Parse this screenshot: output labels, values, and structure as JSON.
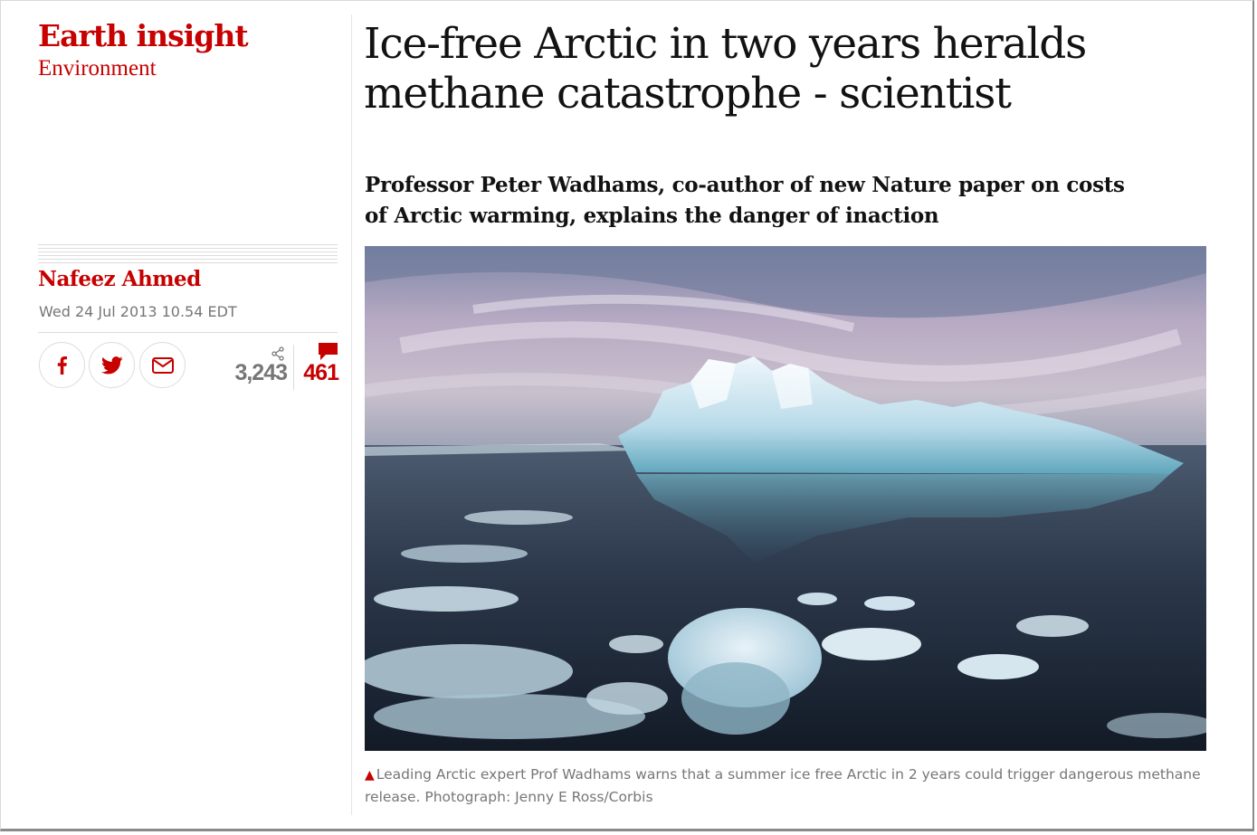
{
  "article": {
    "series": "Earth insight",
    "section": "Environment",
    "headline": "Ice-free Arctic in two years heralds methane catastrophe - scientist",
    "standfirst": "Professor Peter Wadhams, co-author of new Nature paper on costs of Arctic warming, explains the danger of inaction",
    "byline": "Nafeez Ahmed",
    "dateline": "Wed 24 Jul 2013 10.54 EDT"
  },
  "share": {
    "buttons": [
      {
        "name": "facebook",
        "icon": "facebook-icon"
      },
      {
        "name": "twitter",
        "icon": "twitter-icon"
      },
      {
        "name": "email",
        "icon": "email-icon"
      }
    ],
    "share_count": "3,243",
    "comment_count": "461"
  },
  "image": {
    "subject": "iceberg-photo",
    "caption": "Leading Arctic expert Prof Wadhams warns that a summer ice free Arctic in 2 years could trigger dangerous methane release. Photograph: Jenny E Ross/Corbis",
    "caption_marker": "▲"
  },
  "colors": {
    "accent": "#c70000",
    "meta": "#767676",
    "text": "#121212"
  }
}
